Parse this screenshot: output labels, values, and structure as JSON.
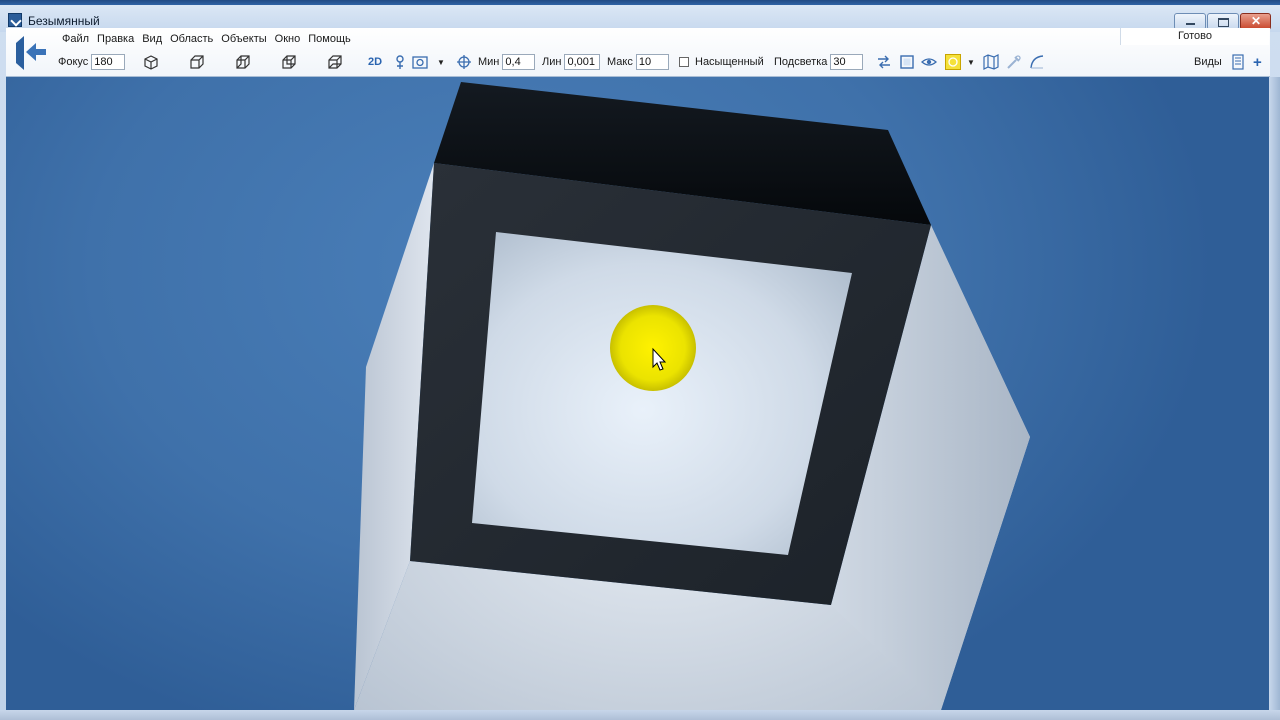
{
  "window": {
    "title": "Безымянный",
    "status": "Готово"
  },
  "menu": {
    "items": [
      "Файл",
      "Правка",
      "Вид",
      "Область",
      "Объекты",
      "Окно",
      "Помощь"
    ]
  },
  "toolbar": {
    "focus_label": "Фокус",
    "focus_value": "180",
    "mode_2d": "2D",
    "min_label": "Мин",
    "min_value": "0,4",
    "lin_label": "Лин",
    "lin_value": "0,001",
    "max_label": "Макс",
    "max_value": "10",
    "saturated_label": "Насыщенный",
    "saturated_checked": false,
    "backlight_label": "Подсветка",
    "backlight_value": "30",
    "views_label": "Виды"
  },
  "icons": {
    "back": "back-arrow-icon",
    "cube": "cube-view-icon",
    "pin": "pin-icon",
    "camera": "camera-icon",
    "crosshair": "crosshair-icon",
    "swap": "swap-arrows-icon",
    "frame": "frame-icon",
    "eye": "eye-icon",
    "light": "light-bulb-icon",
    "map": "map-icon",
    "tools": "tools-icon",
    "curve": "curve-icon",
    "views": "views-grid-icon",
    "add": "plus-icon"
  },
  "colors": {
    "viewport_bg": "#3f71aa",
    "highlight": "#f0ea00",
    "frame_dark": "#1f252d"
  }
}
